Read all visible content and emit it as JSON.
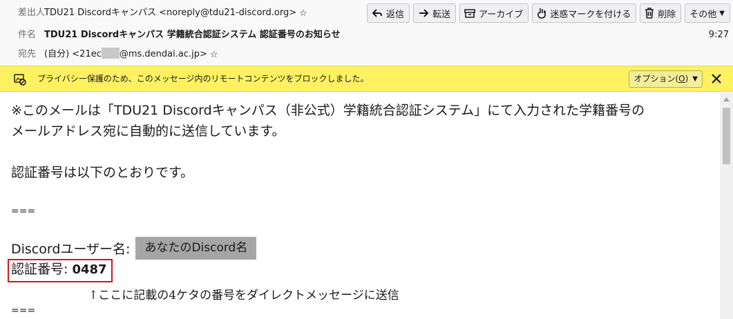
{
  "header": {
    "from_label": "差出人",
    "from_value": "TDU21 Discordキャンパス <noreply@tdu21-discord.org>",
    "subject_label": "件名",
    "subject_value": "TDU21 Discordキャンパス 学籍統合認証システム 認証番号のお知らせ",
    "to_label": "宛先",
    "to_prefix": "(自分) <21ec",
    "to_suffix": "@ms.dendai.ac.jp>",
    "time": "9:27"
  },
  "toolbar": {
    "reply": "返信",
    "forward": "転送",
    "archive": "アーカイブ",
    "junk": "迷惑マークを付ける",
    "delete": "削除",
    "more": "その他"
  },
  "notification": {
    "text": "プライバシー保護のため、このメッセージ内のリモートコンテンツをブロックしました。",
    "options_label": "オプション(",
    "options_key": "O",
    "options_close": ")"
  },
  "body": {
    "line1": "※このメールは「TDU21 Discordキャンパス（非公式）学籍統合認証システム」にて入力された学籍番号の",
    "line2": "メールアドレス宛に自動的に送信しています。",
    "line3": "認証番号は以下のとおりです。",
    "sep1": "===",
    "username_label": "Discordユーザー名:",
    "username_value": "あなたのDiscord名",
    "code_label": "認証番号:",
    "code_value": "0487",
    "annotation": "↑ここに記載の4ケタの番号をダイレクトメッセージに送信",
    "sep2": "==="
  },
  "colors": {
    "notify_bg": "#fff160",
    "highlight_border": "#d8141c",
    "name_chip_bg": "#a5a5a5"
  }
}
